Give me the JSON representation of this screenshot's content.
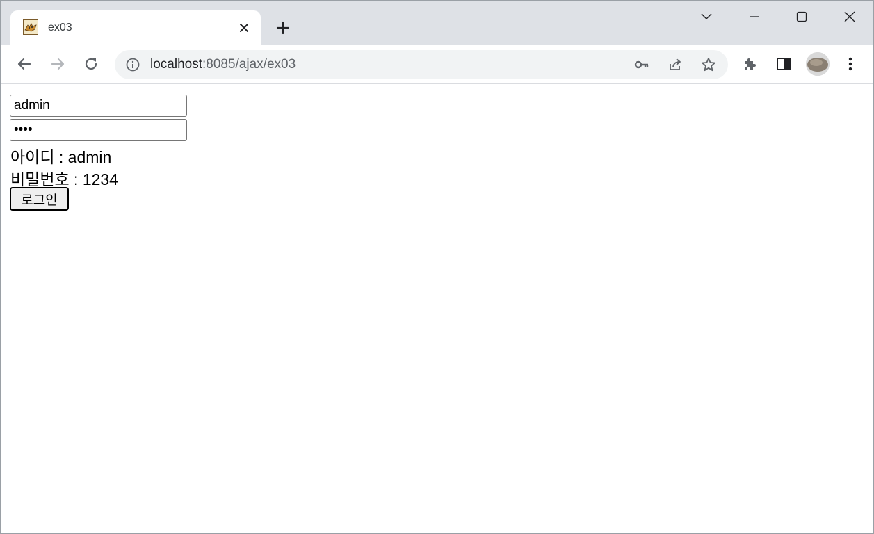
{
  "browser": {
    "tab": {
      "title": "ex03",
      "favicon": "tomcat-favicon-icon"
    },
    "address_bar": {
      "host": "localhost",
      "port_path": ":8085/ajax/ex03"
    },
    "icons": {
      "back": "back-arrow-icon",
      "forward": "forward-arrow-icon",
      "reload": "reload-icon",
      "site_info": "info-icon",
      "password_key": "key-icon",
      "share": "share-icon",
      "bookmark": "star-icon",
      "extensions": "puzzle-icon",
      "side_panel": "side-panel-icon",
      "menu": "kebab-menu-icon"
    },
    "colors": {
      "tabstrip_bg": "#dee1e6",
      "omnibox_bg": "#f1f3f4",
      "icon": "#5f6368"
    }
  },
  "page": {
    "id_input": {
      "value": "admin"
    },
    "password_input": {
      "value": "1234"
    },
    "id_output": {
      "label": "아이디",
      "separator": " : ",
      "value": "admin"
    },
    "password_output": {
      "label": "비밀번호",
      "separator": " : ",
      "value": "1234"
    },
    "login_button": {
      "label": "로그인"
    }
  }
}
